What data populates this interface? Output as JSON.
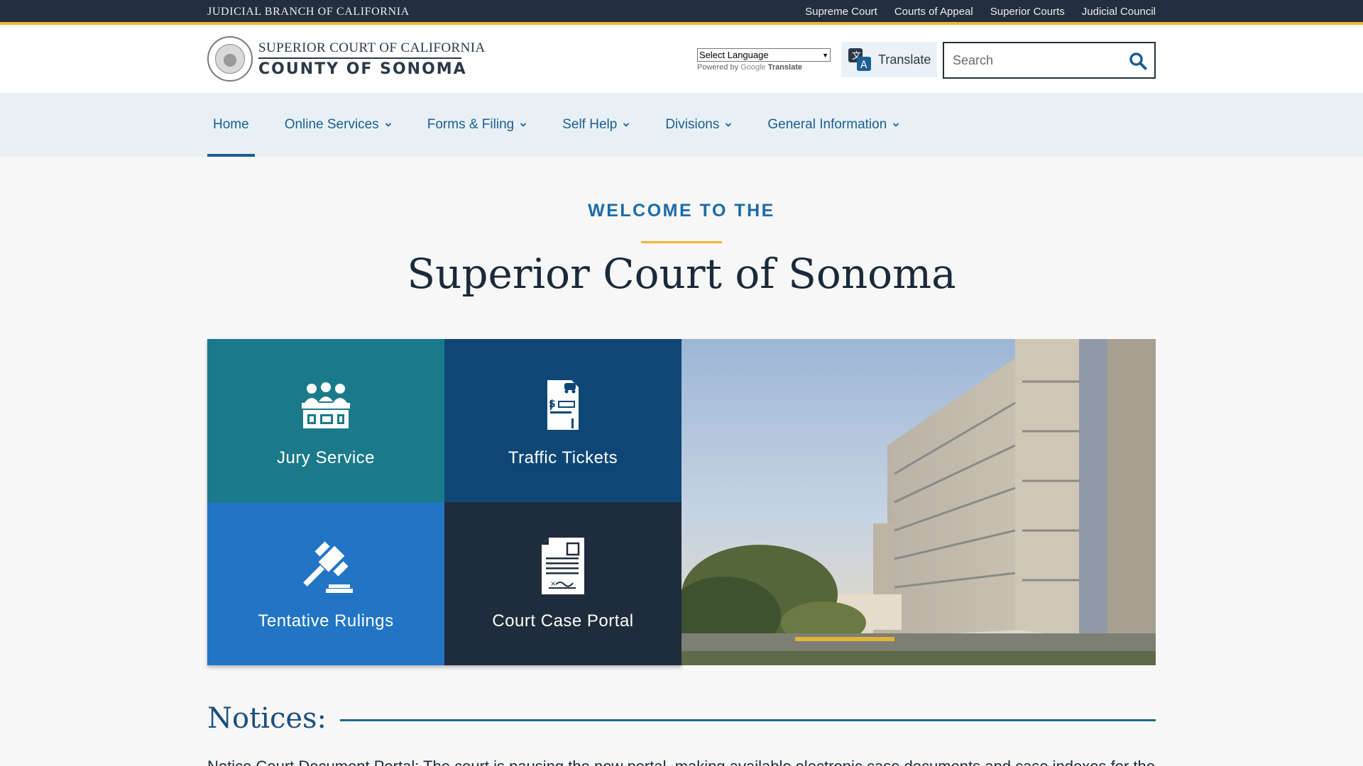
{
  "topbar": {
    "brand": "JUDICIAL BRANCH OF CALIFORNIA",
    "links": [
      "Supreme Court",
      "Courts of Appeal",
      "Superior Courts",
      "Judicial Council"
    ]
  },
  "header": {
    "logo_line1": "SUPERIOR COURT OF CALIFORNIA",
    "logo_line2": "COUNTY OF SONOMA",
    "language_select": "Select Language",
    "powered_by": "Powered by",
    "google": "Google",
    "translate_word": "Translate",
    "translate_button": "Translate",
    "search_placeholder": "Search"
  },
  "nav": {
    "items": [
      {
        "label": "Home",
        "active": true,
        "dropdown": false
      },
      {
        "label": "Online Services",
        "active": false,
        "dropdown": true
      },
      {
        "label": "Forms & Filing",
        "active": false,
        "dropdown": true
      },
      {
        "label": "Self Help",
        "active": false,
        "dropdown": true
      },
      {
        "label": "Divisions",
        "active": false,
        "dropdown": true
      },
      {
        "label": "General Information",
        "active": false,
        "dropdown": true
      }
    ]
  },
  "hero": {
    "kicker": "WELCOME TO THE",
    "title": "Superior Court of Sonoma"
  },
  "tiles": [
    {
      "label": "Jury Service",
      "icon": "jury-icon",
      "color": "#1a7a8a"
    },
    {
      "label": "Traffic Tickets",
      "icon": "traffic-ticket-icon",
      "color": "#0e4775"
    },
    {
      "label": "Tentative Rulings",
      "icon": "gavel-icon",
      "color": "#2175c4"
    },
    {
      "label": "Court Case Portal",
      "icon": "case-document-icon",
      "color": "#1e2c3c"
    }
  ],
  "notices": {
    "heading": "Notices:",
    "text": "Notice Court Document Portal: The court is pausing the new portal, making available electronic case documents and case indexes for the public"
  },
  "colors": {
    "topbar": "#232f3e",
    "accent_gold": "#f2b634",
    "nav_bg": "#e8f0f6",
    "link_blue": "#1a5e92"
  }
}
